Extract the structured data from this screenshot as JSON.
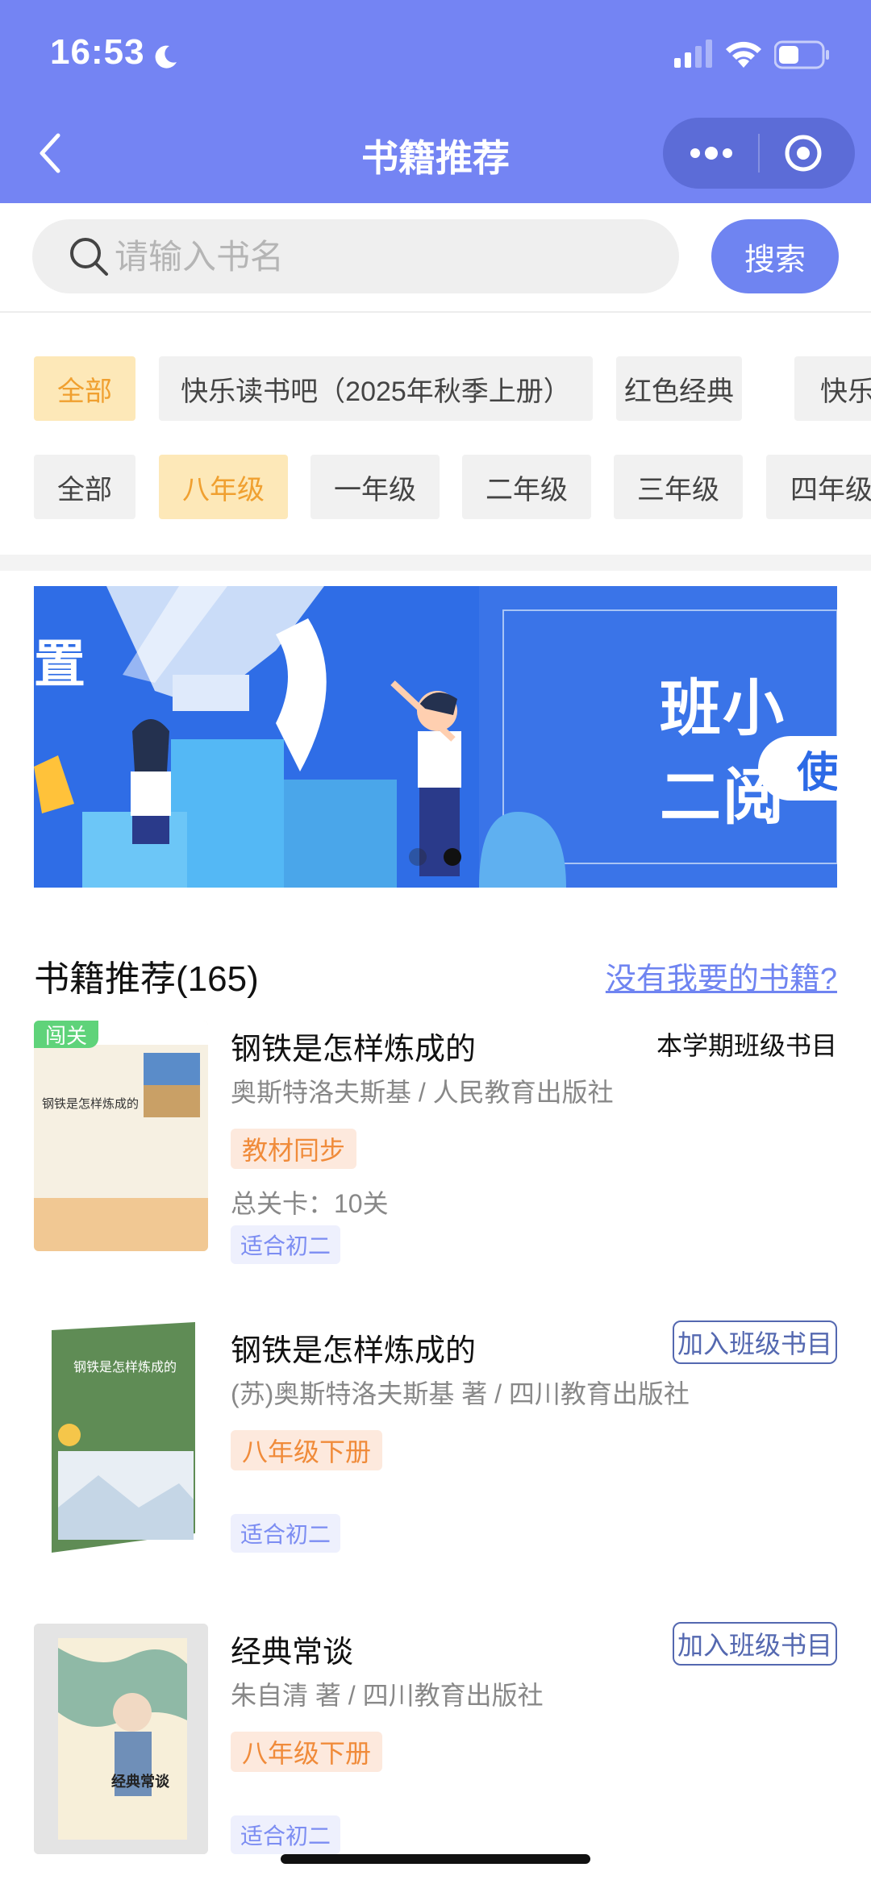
{
  "status_bar": {
    "time": "16:53"
  },
  "nav": {
    "title": "书籍推荐"
  },
  "search": {
    "placeholder": "请输入书名",
    "button_label": "搜索"
  },
  "category_row": [
    "全部",
    "快乐读书吧（2025年秋季上册）",
    "红色经典",
    "快乐"
  ],
  "category_active_index": 0,
  "grade_row": [
    "全部",
    "八年级",
    "一年级",
    "二年级",
    "三年级",
    "四年级"
  ],
  "grade_active_index": 1,
  "banner": {
    "left_text": "置",
    "headline": "班小二阅",
    "button_text": "使",
    "dots_total": 2,
    "active_dot": 2
  },
  "list": {
    "title": "书籍推荐(165)",
    "missing_link": "没有我要的书籍?"
  },
  "books": [
    {
      "title": "钢铁是怎样炼成的",
      "meta": "奥斯特洛夫斯基 / 人民教育出版社",
      "tag": "教材同步",
      "levels": "总关卡：10关",
      "suit": "适合初二",
      "right_label": "本学期班级书目",
      "badge": "闯关",
      "cover_title": "钢铁是怎样炼成的"
    },
    {
      "title": "钢铁是怎样炼成的",
      "meta": "(苏)奥斯特洛夫斯基 著 / 四川教育出版社",
      "tag": "八年级下册",
      "suit": "适合初二",
      "right_label": "加入班级书目",
      "cover_title": "钢铁是怎样炼成的"
    },
    {
      "title": "经典常谈",
      "meta": "朱自清 著 / 四川教育出版社",
      "tag": "八年级下册",
      "suit": "适合初二",
      "right_label": "加入班级书目",
      "cover_title": "经典常谈"
    }
  ],
  "colors": {
    "header": "#7484f3",
    "accent": "#6f84f1",
    "chip_active_bg": "#fde8b8",
    "chip_active_text": "#f0a030",
    "tag_orange": "#f08b3a",
    "tag_blue": "#7c8df2"
  }
}
